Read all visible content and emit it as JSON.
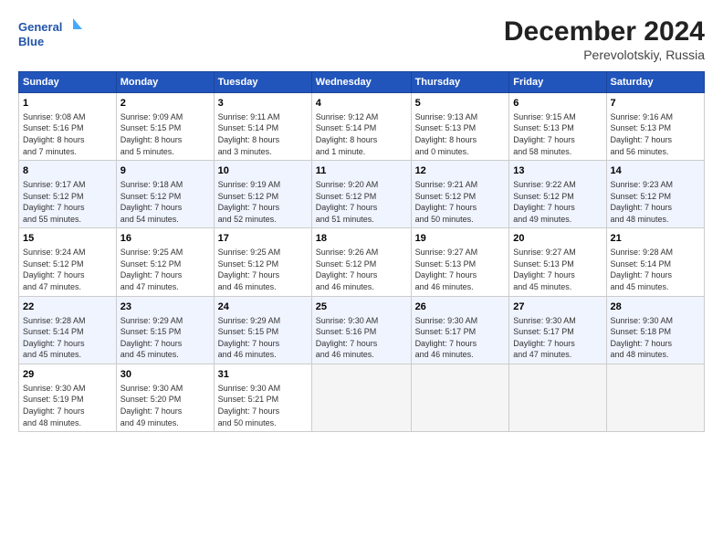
{
  "header": {
    "logo_line1": "General",
    "logo_line2": "Blue",
    "month": "December 2024",
    "location": "Perevolotskiy, Russia"
  },
  "columns": [
    "Sunday",
    "Monday",
    "Tuesday",
    "Wednesday",
    "Thursday",
    "Friday",
    "Saturday"
  ],
  "weeks": [
    [
      {
        "day": "1",
        "info": "Sunrise: 9:08 AM\nSunset: 5:16 PM\nDaylight: 8 hours\nand 7 minutes."
      },
      {
        "day": "2",
        "info": "Sunrise: 9:09 AM\nSunset: 5:15 PM\nDaylight: 8 hours\nand 5 minutes."
      },
      {
        "day": "3",
        "info": "Sunrise: 9:11 AM\nSunset: 5:14 PM\nDaylight: 8 hours\nand 3 minutes."
      },
      {
        "day": "4",
        "info": "Sunrise: 9:12 AM\nSunset: 5:14 PM\nDaylight: 8 hours\nand 1 minute."
      },
      {
        "day": "5",
        "info": "Sunrise: 9:13 AM\nSunset: 5:13 PM\nDaylight: 8 hours\nand 0 minutes."
      },
      {
        "day": "6",
        "info": "Sunrise: 9:15 AM\nSunset: 5:13 PM\nDaylight: 7 hours\nand 58 minutes."
      },
      {
        "day": "7",
        "info": "Sunrise: 9:16 AM\nSunset: 5:13 PM\nDaylight: 7 hours\nand 56 minutes."
      }
    ],
    [
      {
        "day": "8",
        "info": "Sunrise: 9:17 AM\nSunset: 5:12 PM\nDaylight: 7 hours\nand 55 minutes."
      },
      {
        "day": "9",
        "info": "Sunrise: 9:18 AM\nSunset: 5:12 PM\nDaylight: 7 hours\nand 54 minutes."
      },
      {
        "day": "10",
        "info": "Sunrise: 9:19 AM\nSunset: 5:12 PM\nDaylight: 7 hours\nand 52 minutes."
      },
      {
        "day": "11",
        "info": "Sunrise: 9:20 AM\nSunset: 5:12 PM\nDaylight: 7 hours\nand 51 minutes."
      },
      {
        "day": "12",
        "info": "Sunrise: 9:21 AM\nSunset: 5:12 PM\nDaylight: 7 hours\nand 50 minutes."
      },
      {
        "day": "13",
        "info": "Sunrise: 9:22 AM\nSunset: 5:12 PM\nDaylight: 7 hours\nand 49 minutes."
      },
      {
        "day": "14",
        "info": "Sunrise: 9:23 AM\nSunset: 5:12 PM\nDaylight: 7 hours\nand 48 minutes."
      }
    ],
    [
      {
        "day": "15",
        "info": "Sunrise: 9:24 AM\nSunset: 5:12 PM\nDaylight: 7 hours\nand 47 minutes."
      },
      {
        "day": "16",
        "info": "Sunrise: 9:25 AM\nSunset: 5:12 PM\nDaylight: 7 hours\nand 47 minutes."
      },
      {
        "day": "17",
        "info": "Sunrise: 9:25 AM\nSunset: 5:12 PM\nDaylight: 7 hours\nand 46 minutes."
      },
      {
        "day": "18",
        "info": "Sunrise: 9:26 AM\nSunset: 5:12 PM\nDaylight: 7 hours\nand 46 minutes."
      },
      {
        "day": "19",
        "info": "Sunrise: 9:27 AM\nSunset: 5:13 PM\nDaylight: 7 hours\nand 46 minutes."
      },
      {
        "day": "20",
        "info": "Sunrise: 9:27 AM\nSunset: 5:13 PM\nDaylight: 7 hours\nand 45 minutes."
      },
      {
        "day": "21",
        "info": "Sunrise: 9:28 AM\nSunset: 5:14 PM\nDaylight: 7 hours\nand 45 minutes."
      }
    ],
    [
      {
        "day": "22",
        "info": "Sunrise: 9:28 AM\nSunset: 5:14 PM\nDaylight: 7 hours\nand 45 minutes."
      },
      {
        "day": "23",
        "info": "Sunrise: 9:29 AM\nSunset: 5:15 PM\nDaylight: 7 hours\nand 45 minutes."
      },
      {
        "day": "24",
        "info": "Sunrise: 9:29 AM\nSunset: 5:15 PM\nDaylight: 7 hours\nand 46 minutes."
      },
      {
        "day": "25",
        "info": "Sunrise: 9:30 AM\nSunset: 5:16 PM\nDaylight: 7 hours\nand 46 minutes."
      },
      {
        "day": "26",
        "info": "Sunrise: 9:30 AM\nSunset: 5:17 PM\nDaylight: 7 hours\nand 46 minutes."
      },
      {
        "day": "27",
        "info": "Sunrise: 9:30 AM\nSunset: 5:17 PM\nDaylight: 7 hours\nand 47 minutes."
      },
      {
        "day": "28",
        "info": "Sunrise: 9:30 AM\nSunset: 5:18 PM\nDaylight: 7 hours\nand 48 minutes."
      }
    ],
    [
      {
        "day": "29",
        "info": "Sunrise: 9:30 AM\nSunset: 5:19 PM\nDaylight: 7 hours\nand 48 minutes."
      },
      {
        "day": "30",
        "info": "Sunrise: 9:30 AM\nSunset: 5:20 PM\nDaylight: 7 hours\nand 49 minutes."
      },
      {
        "day": "31",
        "info": "Sunrise: 9:30 AM\nSunset: 5:21 PM\nDaylight: 7 hours\nand 50 minutes."
      },
      {
        "day": "",
        "info": ""
      },
      {
        "day": "",
        "info": ""
      },
      {
        "day": "",
        "info": ""
      },
      {
        "day": "",
        "info": ""
      }
    ]
  ]
}
